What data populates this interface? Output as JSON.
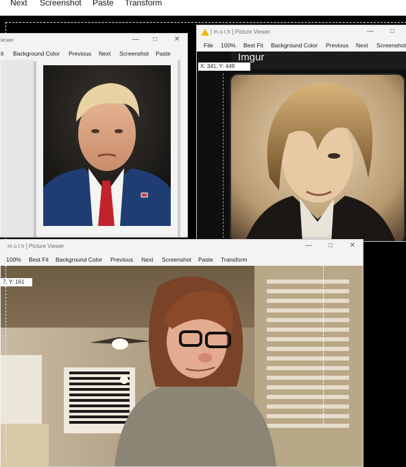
{
  "topbar": {
    "items": [
      "Next",
      "Screenshot",
      "Paste",
      "Transform"
    ]
  },
  "win1": {
    "title_fragment": "iewer",
    "menu": [
      "it",
      "Background Color",
      "Previous",
      "Next",
      "Screenshot",
      "Paste"
    ],
    "controls": [
      "—",
      "□",
      "✕"
    ]
  },
  "win2": {
    "title": "[ m o t h ] Picture Viewer",
    "menu": [
      "File",
      "100%",
      "Best Fit",
      "Background Color",
      "Previous",
      "Next",
      "Screenshot"
    ],
    "controls": [
      "—",
      "□"
    ],
    "coord": "X: 341, Y: 449",
    "overlay": "Imgur"
  },
  "win3": {
    "title": "m o t h ] Picture Viewer",
    "menu": [
      "100%",
      "Best Fit",
      "Background Color",
      "Previous",
      "Next",
      "Screenshot",
      "Paste",
      "Transform"
    ],
    "controls": [
      "—",
      "□",
      "✕"
    ],
    "coord": "7, Y: 161"
  },
  "colors": {
    "accent": "#f2b705",
    "window_bg": "#f3f3f3"
  }
}
